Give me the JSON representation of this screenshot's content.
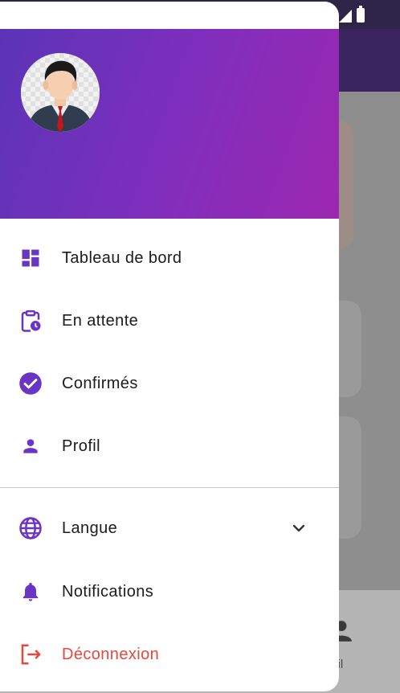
{
  "background_app": {
    "bottom_nav_partial_label": "ofil"
  },
  "drawer": {
    "menu": [
      {
        "id": "dashboard",
        "label": "Tableau de bord",
        "icon": "dashboard-icon"
      },
      {
        "id": "pending",
        "label": "En attente",
        "icon": "clipboard-clock-icon"
      },
      {
        "id": "confirmed",
        "label": "Confirmés",
        "icon": "check-circle-icon"
      },
      {
        "id": "profile",
        "label": "Profil",
        "icon": "person-icon"
      }
    ],
    "settings": [
      {
        "id": "language",
        "label": "Langue",
        "icon": "globe-icon",
        "expandable": true
      },
      {
        "id": "notifications",
        "label": "Notifications",
        "icon": "bell-icon"
      },
      {
        "id": "logout",
        "label": "Déconnexion",
        "icon": "logout-icon"
      }
    ]
  },
  "colors": {
    "accent": "#6a35c4",
    "header_start": "#5a34b6",
    "header_end": "#9c27b0",
    "logout": "#e5483d",
    "text": "#1c1c1c"
  }
}
